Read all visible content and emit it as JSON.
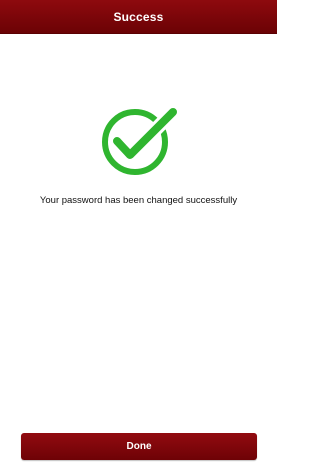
{
  "header": {
    "title": "Success"
  },
  "status": {
    "icon": "checkmark-success-icon",
    "icon_color": "#2fb52f",
    "message": "Your password has been changed successfully"
  },
  "footer": {
    "done_label": "Done"
  },
  "colors": {
    "brand": "#7d0508",
    "background": "#ffffff",
    "text": "#111111"
  }
}
